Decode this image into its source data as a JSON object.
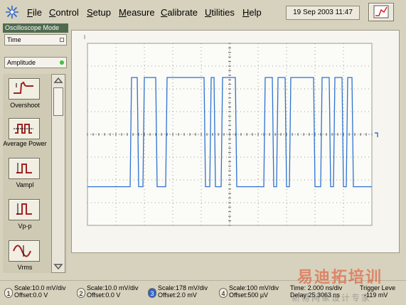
{
  "window": {
    "menu": [
      {
        "key": "F",
        "rest": "ile"
      },
      {
        "key": "C",
        "rest": "ontrol"
      },
      {
        "key": "S",
        "rest": "etup"
      },
      {
        "key": "M",
        "rest": "easure"
      },
      {
        "key": "C",
        "rest": "alibrate"
      },
      {
        "key": "U",
        "rest": "tilities"
      },
      {
        "key": "H",
        "rest": "elp"
      }
    ],
    "datetime": "19 Sep 2003   11:47"
  },
  "sidebar": {
    "mode_title": "Oscilloscope Mode",
    "time_dropdown": "Time",
    "amplitude_dropdown": "Amplitude",
    "measurements": [
      {
        "label": "Overshoot",
        "icon": "overshoot-icon"
      },
      {
        "label": "Average Power",
        "icon": "average-power-icon"
      },
      {
        "label": "Vampl",
        "icon": "vamptd-icon"
      },
      {
        "label": "Vp-p",
        "icon": "vpp-icon"
      },
      {
        "label": "Vrms",
        "icon": "vrms-icon"
      }
    ]
  },
  "channels": [
    {
      "num": "1",
      "scale": "Scale:10.0 mV/div",
      "offset": "Offset:0.0 V",
      "selected": false
    },
    {
      "num": "2",
      "scale": "Scale:10.0 mV/div",
      "offset": "Offset:0.0 V",
      "selected": false
    },
    {
      "num": "3",
      "scale": "Scale:178 mV/div",
      "offset": "Offset:2.0 mV",
      "selected": true
    },
    {
      "num": "4",
      "scale": "Scale:100 mV/div",
      "offset": "Offset:500 µV",
      "selected": false
    }
  ],
  "timebase": {
    "time": "Time: 2.000 ns/div",
    "delay": "Delay:25.3063 ns"
  },
  "trigger": {
    "title": "Trigger Leve",
    "value": "-119 mV"
  },
  "watermark": {
    "big": "易迪拓培训",
    "small": "新易网象设计专家"
  },
  "colors": {
    "trace": "#2e72d2",
    "selected_channel": "#2f62c9",
    "panel": "#d7d2bd"
  },
  "waveform": {
    "units": "divisions",
    "segments": [
      [
        0,
        -2.3
      ],
      [
        1.5,
        -2.3
      ],
      [
        1.55,
        2.5
      ],
      [
        1.75,
        2.5
      ],
      [
        1.8,
        -2.3
      ],
      [
        1.95,
        -2.3
      ],
      [
        2.0,
        2.5
      ],
      [
        2.4,
        2.5
      ],
      [
        2.45,
        -2.3
      ],
      [
        2.75,
        -2.3
      ],
      [
        2.8,
        2.5
      ],
      [
        4.1,
        2.5
      ],
      [
        4.15,
        -2.3
      ],
      [
        4.3,
        -2.3
      ],
      [
        4.35,
        2.5
      ],
      [
        4.45,
        2.5
      ],
      [
        4.5,
        -2.3
      ],
      [
        4.7,
        -2.3
      ],
      [
        4.75,
        2.5
      ],
      [
        5.2,
        2.5
      ],
      [
        5.25,
        -2.3
      ],
      [
        6.2,
        -2.3
      ],
      [
        6.25,
        2.5
      ],
      [
        6.5,
        2.5
      ],
      [
        6.55,
        -2.3
      ],
      [
        6.65,
        -2.3
      ],
      [
        6.7,
        2.5
      ],
      [
        6.95,
        2.5
      ],
      [
        7.0,
        -2.3
      ],
      [
        7.1,
        -2.3
      ],
      [
        7.15,
        2.5
      ],
      [
        7.95,
        2.5
      ],
      [
        8.0,
        -2.3
      ],
      [
        8.2,
        -2.3
      ],
      [
        8.25,
        2.5
      ],
      [
        8.5,
        2.5
      ],
      [
        8.55,
        -2.3
      ],
      [
        8.65,
        -2.3
      ],
      [
        8.7,
        2.5
      ],
      [
        8.95,
        2.5
      ],
      [
        9.0,
        -2.3
      ],
      [
        9.1,
        -2.3
      ],
      [
        9.15,
        2.5
      ],
      [
        9.3,
        2.5
      ],
      [
        9.35,
        -2.3
      ],
      [
        10,
        -2.3
      ]
    ]
  }
}
